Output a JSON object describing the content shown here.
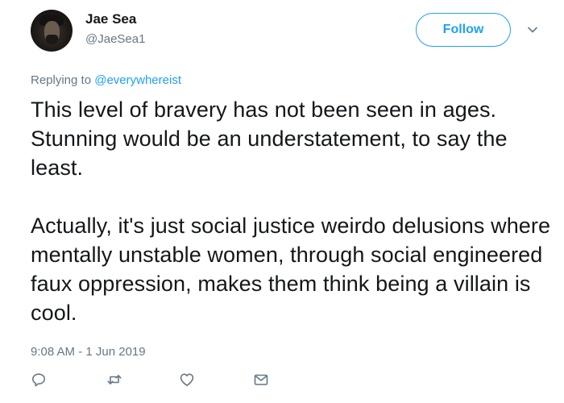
{
  "author": {
    "display_name": "Jae Sea",
    "handle": "@JaeSea1",
    "avatar_icon": "user-avatar"
  },
  "follow_label": "Follow",
  "reply_context": {
    "prefix": "Replying to ",
    "mention": "@everywhereist"
  },
  "tweet": {
    "paragraphs": [
      "This level of bravery has not been seen in ages.  Stunning would be an understatement, to say the least.",
      "Actually, it's just social justice weirdo delusions where mentally unstable women, through social engineered faux oppression, makes them think being a villain is cool."
    ],
    "timestamp": "9:08 AM - 1 Jun 2019"
  },
  "actions": [
    {
      "icon": "reply-icon"
    },
    {
      "icon": "retweet-icon"
    },
    {
      "icon": "like-icon"
    },
    {
      "icon": "direct-message-icon"
    }
  ],
  "colors": {
    "accent": "#1da1f2",
    "secondary_text": "#657786",
    "primary_text": "#14171a"
  }
}
